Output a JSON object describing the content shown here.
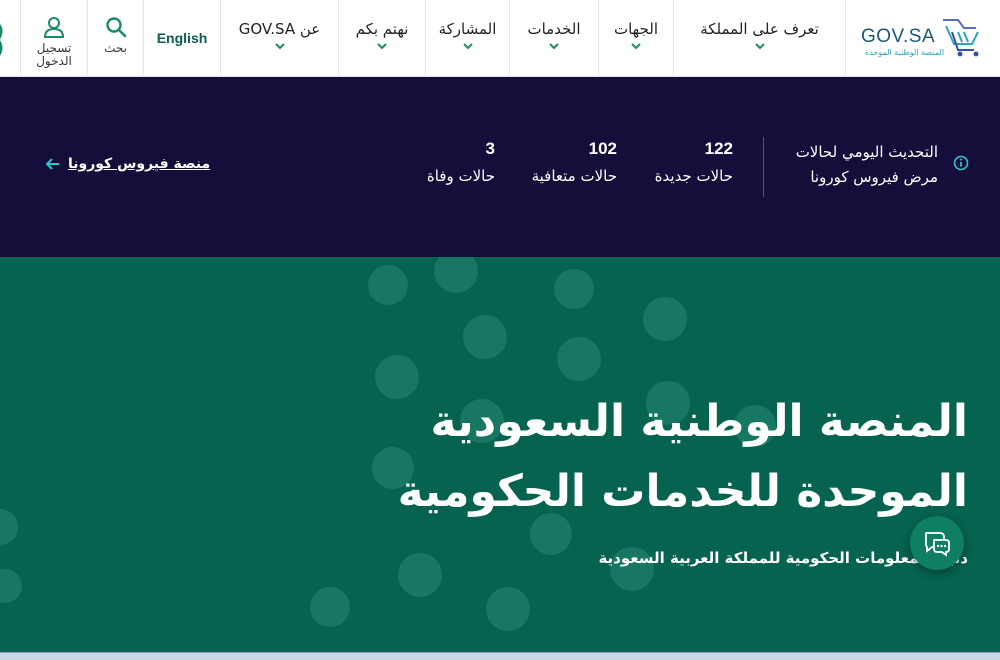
{
  "nav": {
    "logo_text": "GOV.SA",
    "logo_subtitle": "المنصة الوطنية الموحدة",
    "menu": [
      {
        "label": "تعرف على المملكة"
      },
      {
        "label": "الجهات"
      },
      {
        "label": "الخدمات"
      },
      {
        "label": "المشاركة"
      },
      {
        "label": "نهتم بكم"
      },
      {
        "label": "عن GOV.SA"
      }
    ],
    "language": "English",
    "search_label": "بحث",
    "login_label_1": "تسجيل",
    "login_label_2": "الدخول"
  },
  "covid": {
    "title_line1": "التحديث اليومي لحالات",
    "title_line2": "مرض فيروس كورونا",
    "stats": [
      {
        "value": "122",
        "label": "حالات جديدة"
      },
      {
        "value": "102",
        "label": "حالات متعافية"
      },
      {
        "value": "3",
        "label": "حالات وفاة"
      }
    ],
    "link_label": "منصة فيروس كورونا"
  },
  "hero": {
    "title_line1": "المنصة الوطنية السعودية",
    "title_line2": "الموحدة للخدمات الحكومية",
    "subtitle": "دليل المعلومات الحكومية للمملكة العربية السعودية"
  },
  "colors": {
    "header_bg": "#150e3b",
    "hero_bg": "#06634f",
    "accent": "#2aa6b8",
    "chevron": "#1a8a6e"
  }
}
